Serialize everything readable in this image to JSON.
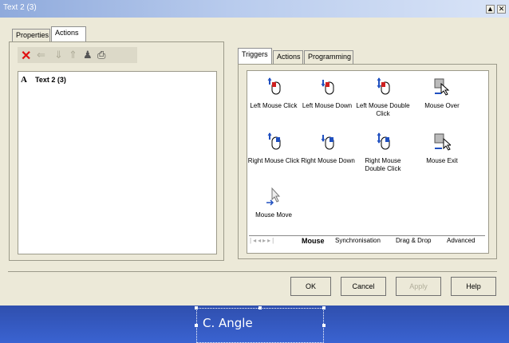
{
  "window": {
    "title": "Text 2 (3)"
  },
  "left": {
    "tabs": [
      "Properties",
      "Actions"
    ],
    "active_tab": "Actions",
    "toolbar_icons": [
      "delete-icon",
      "arrow-left-icon",
      "arrow-down-icon",
      "arrow-up-icon",
      "person-icon",
      "print-icon"
    ],
    "object_badge": "A",
    "object_label": "Text 2 (3)"
  },
  "right": {
    "tabs": [
      "Triggers",
      "Actions",
      "Programming"
    ],
    "active_tab": "Triggers",
    "triggers": [
      "Left Mouse Click",
      "Left Mouse Down",
      "Left Mouse Double Click",
      "Mouse Over",
      "Right Mouse Click",
      "Right Mouse Down",
      "Right Mouse Double Click",
      "Mouse Exit",
      "Mouse Move"
    ],
    "bottom_tabs": [
      "Mouse",
      "Synchronisation",
      "Drag & Drop",
      "Advanced"
    ],
    "active_bottom_tab": "Mouse"
  },
  "buttons": {
    "ok": "OK",
    "cancel": "Cancel",
    "apply": "Apply",
    "help": "Help"
  },
  "canvas": {
    "selected_text": "C. Angle"
  },
  "colors": {
    "title_bar": "#9ab0e0",
    "canvas_bg": "#3358c4",
    "delete_red": "#e01010"
  }
}
